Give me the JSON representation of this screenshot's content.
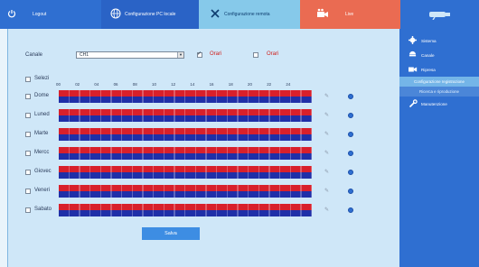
{
  "topbar": {
    "logout": "Logout",
    "local_config": "Configurazione PC locale",
    "remote_config": "Configurazione remota",
    "live": "Live"
  },
  "sidebar": {
    "items": [
      {
        "label": "Sistema"
      },
      {
        "label": "Canale"
      },
      {
        "label": "Ripresa"
      }
    ],
    "sub_active": "Configurazione registrazione",
    "sub_plain": "Ricerca e riproduzione",
    "maintenance": "Manutenzione"
  },
  "form": {
    "channel_label": "Canale",
    "channel_value": "CH1",
    "schedule_label_1": "Orari",
    "schedule_label_2": "Orari",
    "select_all_label": "Selezi"
  },
  "hours": [
    "00",
    "02",
    "04",
    "06",
    "08",
    "10",
    "12",
    "14",
    "16",
    "18",
    "20",
    "22",
    "24"
  ],
  "days": [
    "Dome",
    "Luned",
    "Marte",
    "Mercc",
    "Giovec",
    "Veneri",
    "Sabato"
  ],
  "save_label": "Salva",
  "colors": {
    "accent": "#2f6fd1",
    "panel": "#cfe7f8",
    "record_red": "#d8202b",
    "record_blue": "#1f2fa8",
    "live_tab": "#ea6b52"
  }
}
